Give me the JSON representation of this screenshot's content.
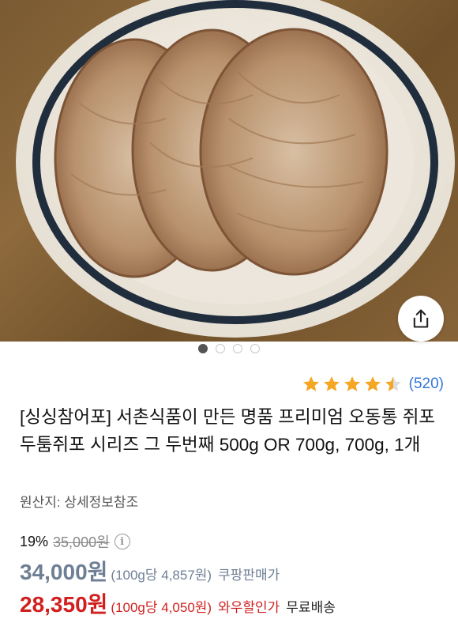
{
  "product_image": {
    "alt": "",
    "icon": "dried-fish-on-plate-photo"
  },
  "share_button": {
    "icon": "share-icon"
  },
  "carousel": {
    "count": 4,
    "active_index": 0
  },
  "rating": {
    "stars": 4.5,
    "max": 5,
    "count_text": "(520)",
    "star_color": "#f5a623"
  },
  "product": {
    "title": "[싱싱참어포] 서촌식품이 만든 명품 프리미엄 오동통 쥐포 두툼쥐포 시리즈 그 두번째 500g OR 700g, 700g, 1개",
    "origin": "원산지: 상세정보참조"
  },
  "pricing": {
    "discount_rate": "19%",
    "original_price": "35,000원",
    "sale_price": "34,000원",
    "sale_unit_price": "(100g당 4,857원)",
    "sale_tag": "쿠팡판매가",
    "wow_price": "28,350원",
    "wow_unit_price": "(100g당 4,050원)",
    "wow_tag": "와우할인가",
    "shipping": "무료배송",
    "colors": {
      "sale": "#6e7f95",
      "wow": "#d11f1f"
    }
  }
}
